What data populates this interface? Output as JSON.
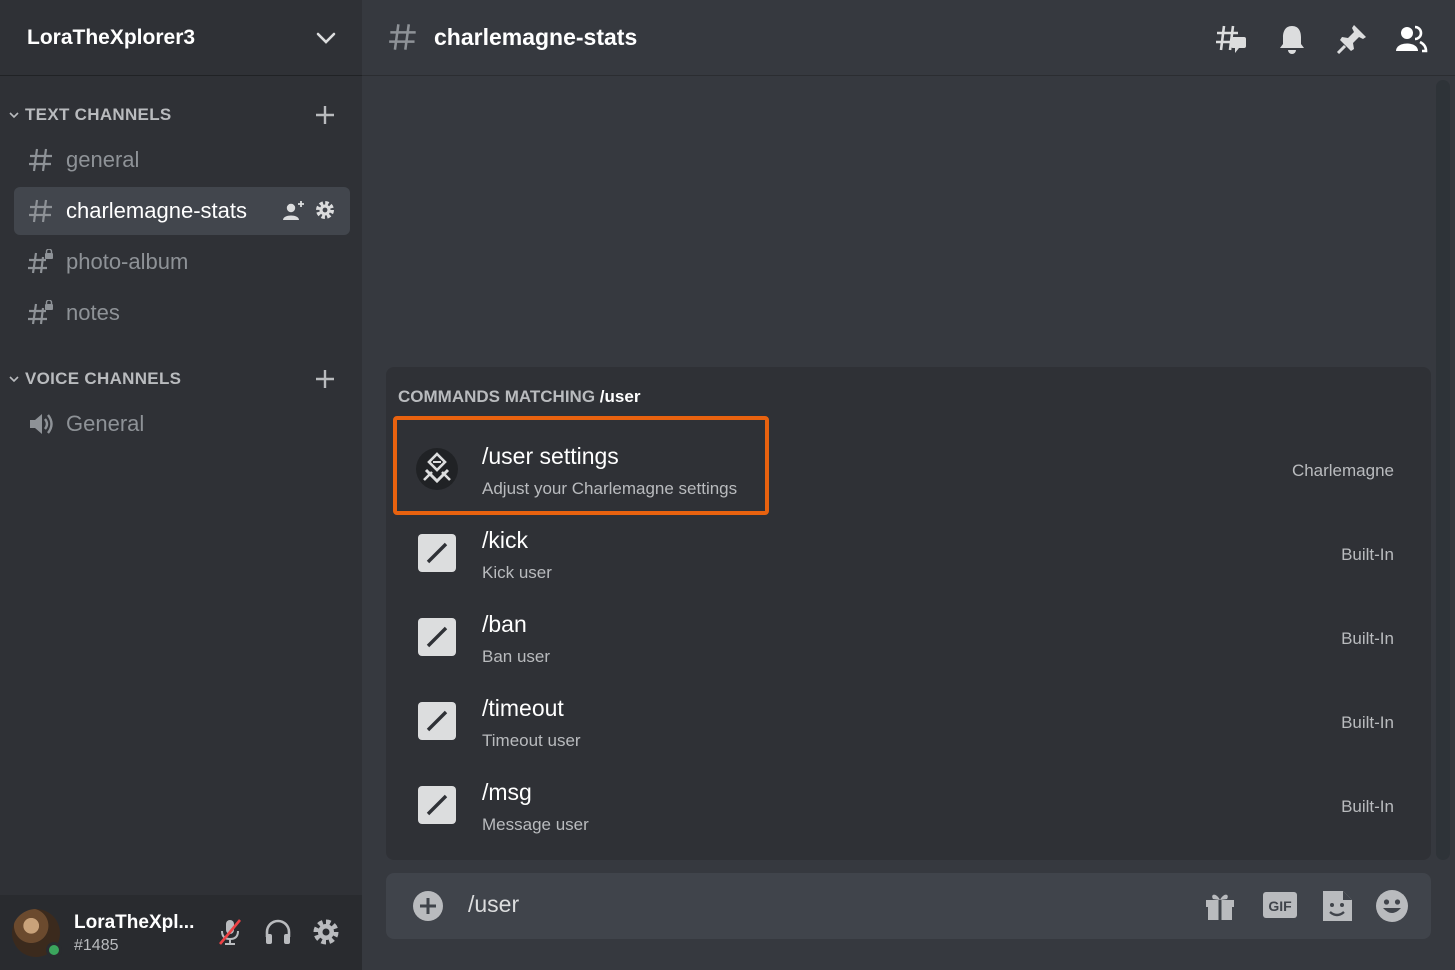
{
  "server": {
    "name": "LoraTheXplorer3"
  },
  "sidebar": {
    "text_category": "TEXT CHANNELS",
    "voice_category": "VOICE CHANNELS",
    "text_channels": [
      {
        "label": "general"
      },
      {
        "label": "charlemagne-stats"
      },
      {
        "label": "photo-album"
      },
      {
        "label": "notes"
      }
    ],
    "voice_channels": [
      {
        "label": "General"
      }
    ]
  },
  "user": {
    "name": "LoraTheXpl...",
    "tag": "#1485"
  },
  "header": {
    "channel": "charlemagne-stats"
  },
  "popup": {
    "header_prefix": "COMMANDS MATCHING",
    "query": "/user",
    "commands": [
      {
        "name": "/user settings",
        "description": "Adjust your Charlemagne settings",
        "source": "Charlemagne"
      },
      {
        "name": "/kick",
        "description": "Kick user",
        "source": "Built-In"
      },
      {
        "name": "/ban",
        "description": "Ban user",
        "source": "Built-In"
      },
      {
        "name": "/timeout",
        "description": "Timeout user",
        "source": "Built-In"
      },
      {
        "name": "/msg",
        "description": "Message user",
        "source": "Built-In"
      }
    ]
  },
  "composer": {
    "value": "/user",
    "gif_label": "GIF"
  },
  "colors": {
    "accent_highlight": "#e8620f",
    "online": "#3ba55d",
    "mute_slash": "#ed4245"
  }
}
